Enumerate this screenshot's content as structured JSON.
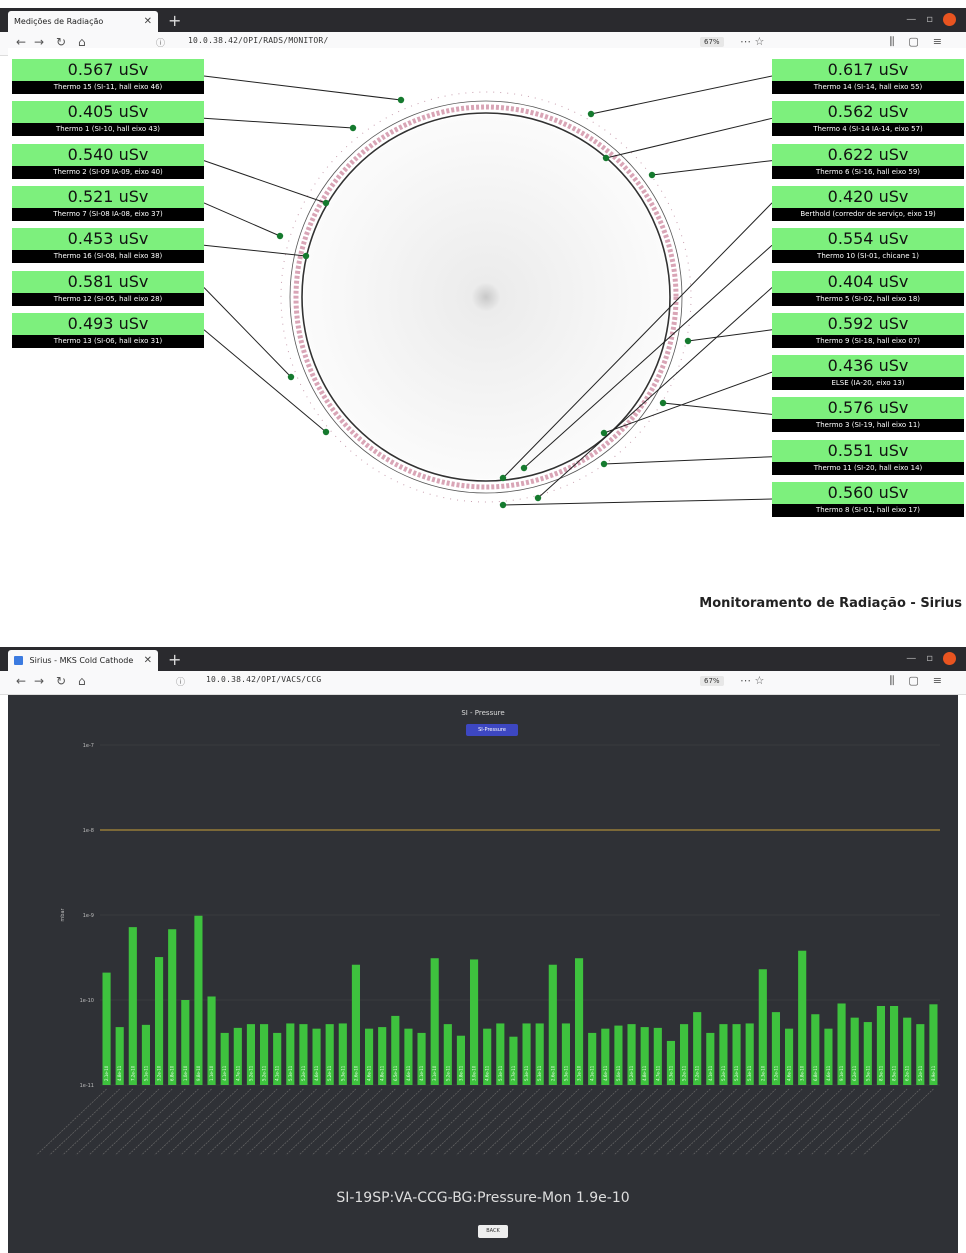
{
  "top_window": {
    "tab_title": "Medições de Radiação",
    "url": "10.0.38.42/OPI/RADS/MONITOR/",
    "zoom": "67%"
  },
  "radiation": {
    "title": "Monitoramento de Radiação - Sirius",
    "left_monitors": [
      {
        "value": "0.567 uSv",
        "label": "Thermo 15 (SI-11, hall eixo 46)"
      },
      {
        "value": "0.405 uSv",
        "label": "Thermo 1 (SI-10, hall eixo 43)"
      },
      {
        "value": "0.540 uSv",
        "label": "Thermo 2 (SI-09 IA-09, eixo 40)"
      },
      {
        "value": "0.521 uSv",
        "label": "Thermo 7 (SI-08 IA-08, eixo 37)"
      },
      {
        "value": "0.453 uSv",
        "label": "Thermo 16 (SI-08, hall eixo 38)"
      },
      {
        "value": "0.581 uSv",
        "label": "Thermo 12 (SI-05, hall eixo 28)"
      },
      {
        "value": "0.493 uSv",
        "label": "Thermo 13 (SI-06, hall eixo 31)"
      }
    ],
    "right_monitors": [
      {
        "value": "0.617 uSv",
        "label": "Thermo 14 (SI-14, hall eixo 55)"
      },
      {
        "value": "0.562 uSv",
        "label": "Thermo 4 (SI-14 IA-14, eixo 57)"
      },
      {
        "value": "0.622 uSv",
        "label": "Thermo 6 (SI-16, hall eixo 59)"
      },
      {
        "value": "0.420 uSv",
        "label": "Berthold (corredor de serviço, eixo 19)"
      },
      {
        "value": "0.554 uSv",
        "label": "Thermo 10 (SI-01, chicane 1)"
      },
      {
        "value": "0.404 uSv",
        "label": "Thermo 5 (SI-02, hall eixo 18)"
      },
      {
        "value": "0.592 uSv",
        "label": "Thermo 9 (SI-18, hall eixo 07)"
      },
      {
        "value": "0.436 uSv",
        "label": "ELSE (IA-20, eixo 13)"
      },
      {
        "value": "0.576 uSv",
        "label": "Thermo 3 (SI-19, hall eixo 11)"
      },
      {
        "value": "0.551 uSv",
        "label": "Thermo 11 (SI-20, hall eixo 14)"
      },
      {
        "value": "0.560 uSv",
        "label": "Thermo 8 (SI-01, hall eixo 17)"
      }
    ]
  },
  "bottom_window": {
    "tab_title": "Sirius - MKS Cold Cathode",
    "url": "10.0.38.42/OPI/VACS/CCG",
    "zoom": "67%"
  },
  "vacuum": {
    "selected_readout": "SI-19SP:VA-CCG-BG:Pressure-Mon 1.9e-10",
    "legend_button": "SI-Pressure",
    "back_button": "BACK",
    "colors": {
      "bar": "#3ec23e",
      "threshold": "#c9a13a",
      "background": "#2f3136"
    }
  },
  "chart_data": {
    "type": "bar",
    "title": "SI - Pressure",
    "ylabel": "mbar",
    "log_scale": true,
    "ylim": [
      1e-11,
      1e-07
    ],
    "threshold": 1e-08,
    "values": [
      2.1e-10,
      4.8e-11,
      7.2e-10,
      5.1e-11,
      3.2e-10,
      6.8e-10,
      1e-10,
      9.8e-10,
      1.1e-10,
      4.1e-11,
      4.7e-11,
      5.2e-11,
      5.2e-11,
      4.1e-11,
      5.3e-11,
      5.2e-11,
      4.6e-11,
      5.2e-11,
      5.3e-11,
      2.6e-10,
      4.6e-11,
      4.8e-11,
      6.5e-11,
      4.6e-11,
      4.1e-11,
      3.1e-10,
      5.2e-11,
      3.8e-11,
      3e-10,
      4.6e-11,
      5.3e-11,
      3.7e-11,
      5.3e-11,
      5.3e-11,
      2.6e-10,
      5.3e-11,
      3.1e-10,
      4.1e-11,
      4.6e-11,
      5e-11,
      5.2e-11,
      4.8e-11,
      4.7e-11,
      3.3e-11,
      5.2e-11,
      7.2e-11,
      4.1e-11,
      5.2e-11,
      5.2e-11,
      5.3e-11,
      2.3e-10,
      7.2e-11,
      4.6e-11,
      3.8e-10,
      6.8e-11,
      4.6e-11,
      9.1e-11,
      6.2e-11,
      5.5e-11,
      8.5e-11,
      8.5e-11,
      6.2e-11,
      5.2e-11,
      8.9e-11
    ]
  }
}
